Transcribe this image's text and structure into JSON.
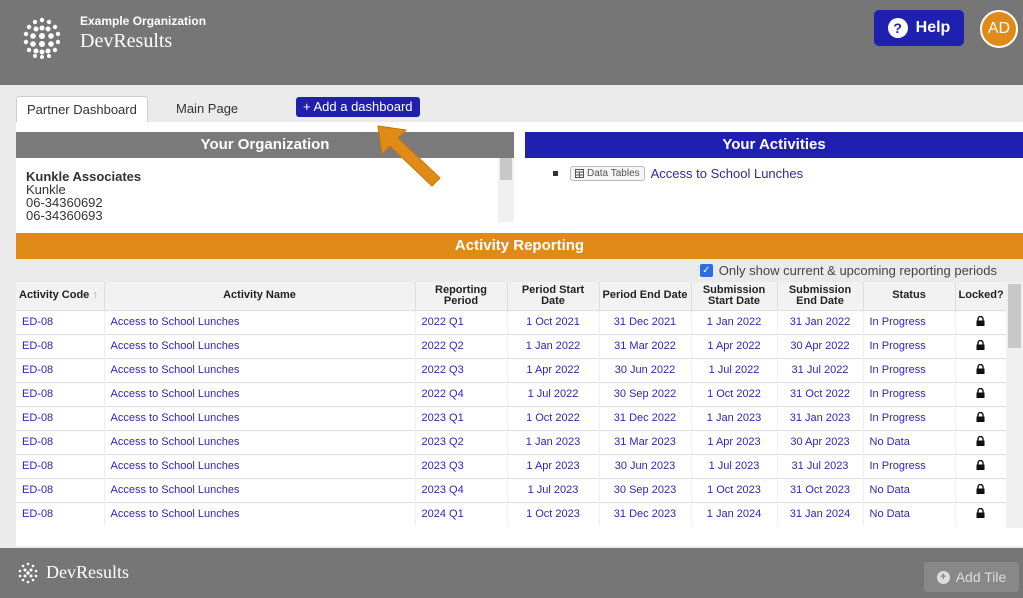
{
  "header": {
    "org_name": "Example Organization",
    "app_name": "DevResults",
    "help_label": "Help",
    "avatar_initials": "AD",
    "colors": {
      "bar": "#767676",
      "accent_blue": "#2020b0",
      "accent_orange": "#e08a18"
    }
  },
  "tabs": [
    {
      "label": "Partner Dashboard"
    },
    {
      "label": "Main Page"
    }
  ],
  "add_dashboard_label": "+ Add a dashboard",
  "org_panel": {
    "title": "Your Organization",
    "name": "Kunkle Associates",
    "lines": [
      "Kunkle",
      "06-34360692",
      "06-34360693"
    ]
  },
  "activities_panel": {
    "title": "Your Activities",
    "badge_label": "Data Tables",
    "badge_icon": "table-icon",
    "item_link": "Access to School Lunches"
  },
  "reporting": {
    "title": "Activity Reporting",
    "filter_label": "Only show current & upcoming reporting periods",
    "filter_checked": true,
    "columns": [
      "Activity Code",
      "Activity Name",
      "Reporting Period",
      "Period Start Date",
      "Period End Date",
      "Submission Start Date",
      "Submission End Date",
      "Status",
      "Locked?"
    ],
    "rows": [
      {
        "code": "ED-08",
        "name": "Access to School Lunches",
        "period": "2022 Q1",
        "pstart": "1 Oct 2021",
        "pend": "31 Dec 2021",
        "sstart": "1 Jan 2022",
        "send": "31 Jan 2022",
        "status": "In Progress"
      },
      {
        "code": "ED-08",
        "name": "Access to School Lunches",
        "period": "2022 Q2",
        "pstart": "1 Jan 2022",
        "pend": "31 Mar 2022",
        "sstart": "1 Apr 2022",
        "send": "30 Apr 2022",
        "status": "In Progress"
      },
      {
        "code": "ED-08",
        "name": "Access to School Lunches",
        "period": "2022 Q3",
        "pstart": "1 Apr 2022",
        "pend": "30 Jun 2022",
        "sstart": "1 Jul 2022",
        "send": "31 Jul 2022",
        "status": "In Progress"
      },
      {
        "code": "ED-08",
        "name": "Access to School Lunches",
        "period": "2022 Q4",
        "pstart": "1 Jul 2022",
        "pend": "30 Sep 2022",
        "sstart": "1 Oct 2022",
        "send": "31 Oct 2022",
        "status": "In Progress"
      },
      {
        "code": "ED-08",
        "name": "Access to School Lunches",
        "period": "2023 Q1",
        "pstart": "1 Oct 2022",
        "pend": "31 Dec 2022",
        "sstart": "1 Jan 2023",
        "send": "31 Jan 2023",
        "status": "In Progress"
      },
      {
        "code": "ED-08",
        "name": "Access to School Lunches",
        "period": "2023 Q2",
        "pstart": "1 Jan 2023",
        "pend": "31 Mar 2023",
        "sstart": "1 Apr 2023",
        "send": "30 Apr 2023",
        "status": "No Data"
      },
      {
        "code": "ED-08",
        "name": "Access to School Lunches",
        "period": "2023 Q3",
        "pstart": "1 Apr 2023",
        "pend": "30 Jun 2023",
        "sstart": "1 Jul 2023",
        "send": "31 Jul 2023",
        "status": "In Progress"
      },
      {
        "code": "ED-08",
        "name": "Access to School Lunches",
        "period": "2023 Q4",
        "pstart": "1 Jul 2023",
        "pend": "30 Sep 2023",
        "sstart": "1 Oct 2023",
        "send": "31 Oct 2023",
        "status": "No Data"
      },
      {
        "code": "ED-08",
        "name": "Access to School Lunches",
        "period": "2024 Q1",
        "pstart": "1 Oct 2023",
        "pend": "31 Dec 2023",
        "sstart": "1 Jan 2024",
        "send": "31 Jan 2024",
        "status": "No Data"
      }
    ]
  },
  "footer": {
    "app_name": "DevResults",
    "add_tile_label": "Add Tile"
  }
}
